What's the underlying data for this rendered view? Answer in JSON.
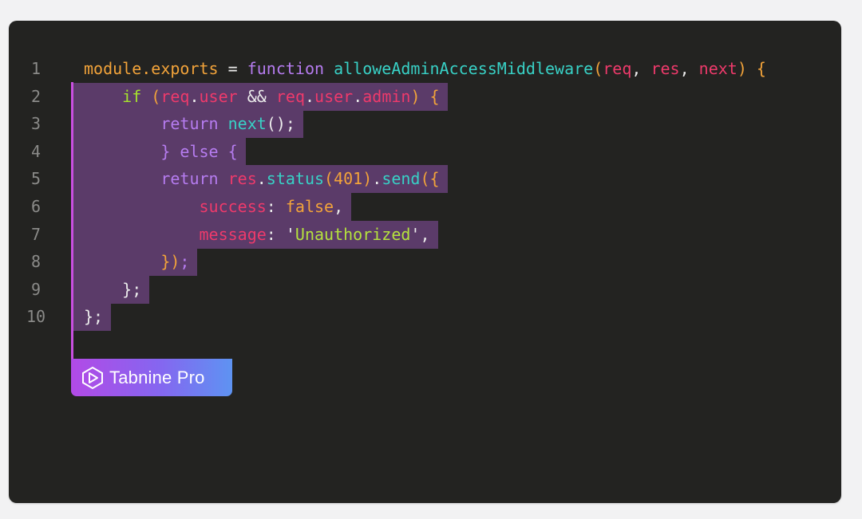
{
  "editor": {
    "lines": [
      {
        "number": "1",
        "tokens": [
          {
            "text": "module.exports",
            "color": "#f2a33a"
          },
          {
            "text": " = ",
            "color": "#ececec"
          },
          {
            "text": "function ",
            "color": "#b67cf0"
          },
          {
            "text": "alloweAdminAccessMiddleware",
            "color": "#38d1c6"
          },
          {
            "text": "(",
            "color": "#f2a33a"
          },
          {
            "text": "req",
            "color": "#ee3a6b"
          },
          {
            "text": ", ",
            "color": "#ececec"
          },
          {
            "text": "res",
            "color": "#ee3a6b"
          },
          {
            "text": ", ",
            "color": "#ececec"
          },
          {
            "text": "next",
            "color": "#ee3a6b"
          },
          {
            "text": ") {",
            "color": "#f2a33a"
          }
        ]
      },
      {
        "number": "2",
        "tokens": [
          {
            "text": "    if ",
            "color": "#a6e22e"
          },
          {
            "text": "(",
            "color": "#f2a33a"
          },
          {
            "text": "req",
            "color": "#ee3a6b"
          },
          {
            "text": ".",
            "color": "#ececec"
          },
          {
            "text": "user",
            "color": "#ee3a6b"
          },
          {
            "text": " && ",
            "color": "#ececec"
          },
          {
            "text": "req",
            "color": "#ee3a6b"
          },
          {
            "text": ".",
            "color": "#ececec"
          },
          {
            "text": "user",
            "color": "#ee3a6b"
          },
          {
            "text": ".",
            "color": "#ececec"
          },
          {
            "text": "admin",
            "color": "#ee3a6b"
          },
          {
            "text": ") {",
            "color": "#f2a33a"
          }
        ]
      },
      {
        "number": "3",
        "tokens": [
          {
            "text": "        return ",
            "color": "#b67cf0"
          },
          {
            "text": "next",
            "color": "#38d1c6"
          },
          {
            "text": "();",
            "color": "#ececec"
          }
        ]
      },
      {
        "number": "4",
        "tokens": [
          {
            "text": "        } else {",
            "color": "#b67cf0"
          }
        ]
      },
      {
        "number": "5",
        "tokens": [
          {
            "text": "        return ",
            "color": "#b67cf0"
          },
          {
            "text": "res",
            "color": "#ee3a6b"
          },
          {
            "text": ".",
            "color": "#ececec"
          },
          {
            "text": "status",
            "color": "#38d1c6"
          },
          {
            "text": "(",
            "color": "#f2a33a"
          },
          {
            "text": "401",
            "color": "#f2a33a"
          },
          {
            "text": ")",
            "color": "#f2a33a"
          },
          {
            "text": ".",
            "color": "#ececec"
          },
          {
            "text": "send",
            "color": "#38d1c6"
          },
          {
            "text": "({",
            "color": "#f2a33a"
          }
        ]
      },
      {
        "number": "6",
        "tokens": [
          {
            "text": "            success",
            "color": "#ee3a6b"
          },
          {
            "text": ": ",
            "color": "#ececec"
          },
          {
            "text": "false",
            "color": "#f2a33a"
          },
          {
            "text": ",",
            "color": "#ececec"
          }
        ]
      },
      {
        "number": "7",
        "tokens": [
          {
            "text": "            message",
            "color": "#ee3a6b"
          },
          {
            "text": ": ",
            "color": "#ececec"
          },
          {
            "text": "'",
            "color": "#ececec"
          },
          {
            "text": "Unauthorized",
            "color": "#b5e33d"
          },
          {
            "text": "'",
            "color": "#ececec"
          },
          {
            "text": ",",
            "color": "#ececec"
          }
        ]
      },
      {
        "number": "8",
        "tokens": [
          {
            "text": "        })",
            "color": "#f2a33a"
          },
          {
            "text": ";",
            "color": "#b67cf0"
          }
        ]
      },
      {
        "number": "9",
        "tokens": [
          {
            "text": "    };",
            "color": "#ececec"
          }
        ]
      },
      {
        "number": "10",
        "tokens": [
          {
            "text": "};",
            "color": "#ececec"
          }
        ]
      }
    ],
    "highlighted_lines": [
      2,
      3,
      4,
      5,
      6,
      7,
      8,
      9,
      10
    ],
    "colors": {
      "background": "#232321",
      "selection": "#5b3b69",
      "gutter_bar": "#c94fe0"
    }
  },
  "badge": {
    "label": "Tabnine Pro",
    "icon": "tabnine-logo-icon"
  }
}
